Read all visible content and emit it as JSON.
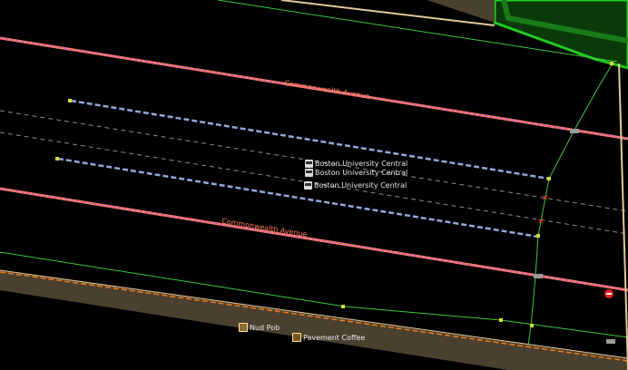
{
  "streets": {
    "upper_label": "Commonwealth Avenue",
    "lower_label": "Commonwealth Avenue"
  },
  "stops": [
    {
      "label": "Boston University Central",
      "icon": "bus-stop-icon"
    },
    {
      "label": "Boston University Central",
      "icon": "bus-stop-icon"
    },
    {
      "label": "Boston University Central",
      "icon": "bus-stop-icon"
    }
  ],
  "pois": [
    {
      "label": "Nud Pob",
      "icon": "restaurant-icon"
    },
    {
      "label": "Pavement Coffee",
      "icon": "cafe-icon"
    }
  ],
  "colors": {
    "background": "#000000",
    "road": "#f08060",
    "road_dash": "#d040ff",
    "busway": "#8fa8d8",
    "footway": "#3cc83c",
    "building": "#22cc22",
    "rail": "#6b5a4a",
    "rail_dash": "#f07818",
    "track_dash": "#8a8a8a"
  }
}
